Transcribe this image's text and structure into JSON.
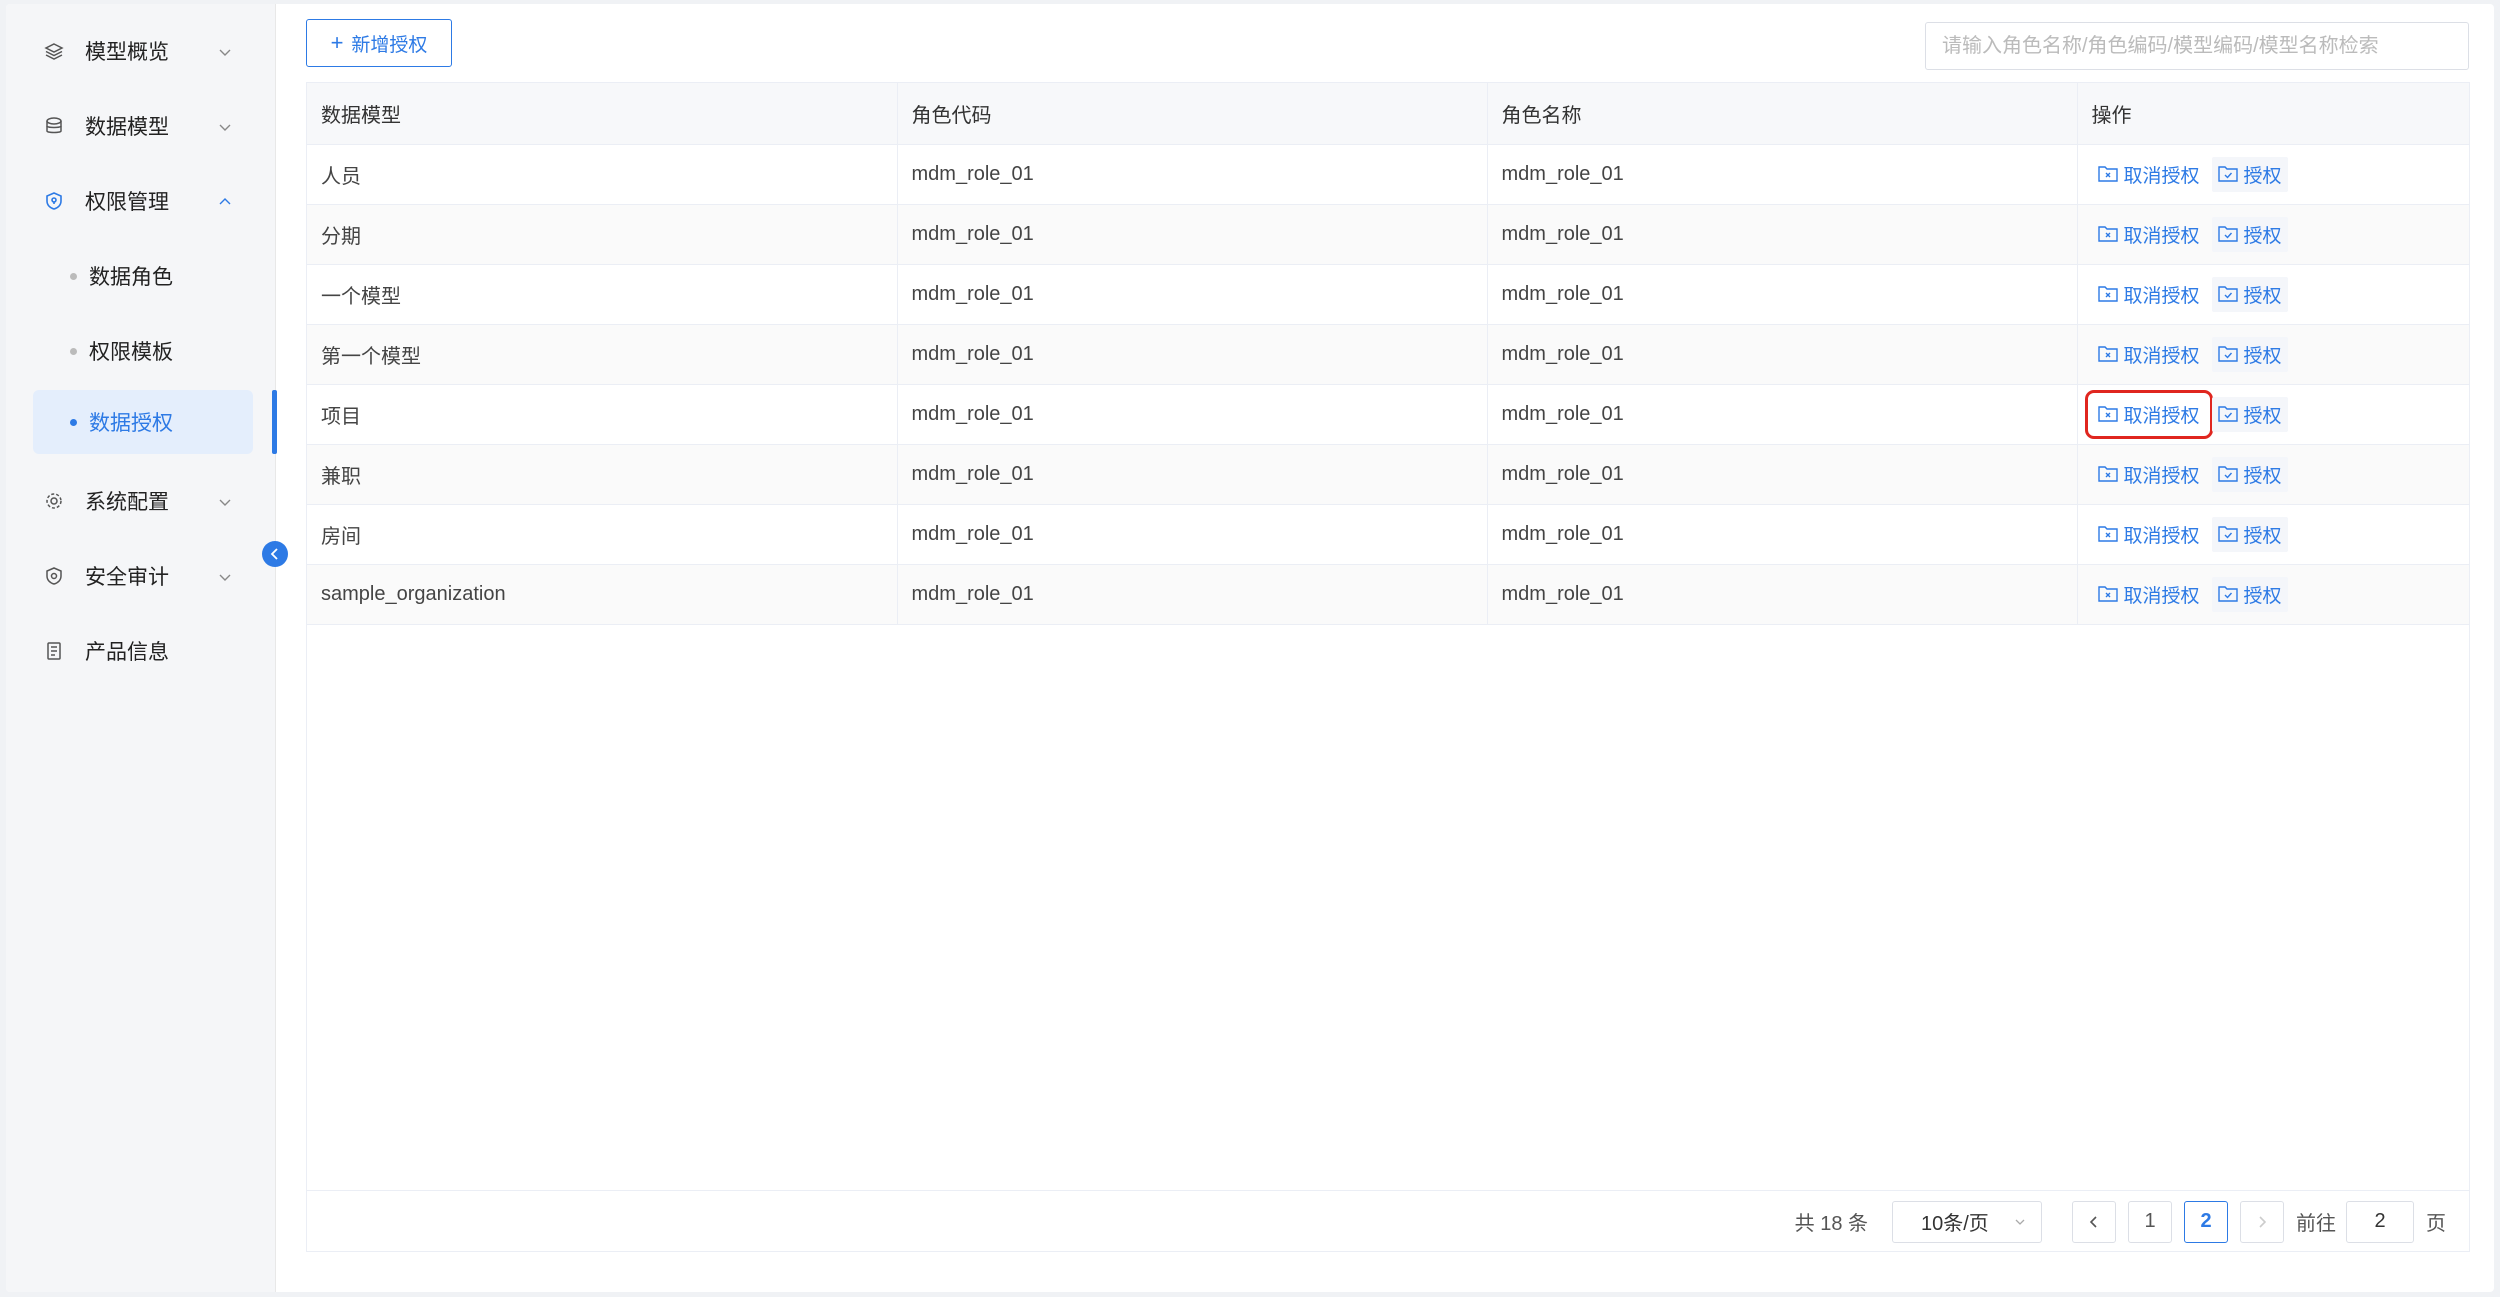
{
  "sidebar": {
    "items": [
      {
        "label": "模型概览",
        "icon": "layers-icon",
        "expanded": false
      },
      {
        "label": "数据模型",
        "icon": "database-icon",
        "expanded": false
      },
      {
        "label": "权限管理",
        "icon": "shield-icon",
        "expanded": true
      },
      {
        "label": "数据角色",
        "sub": true
      },
      {
        "label": "权限模板",
        "sub": true
      },
      {
        "label": "数据授权",
        "sub": true,
        "active": true
      },
      {
        "label": "系统配置",
        "icon": "gear-icon",
        "expanded": false
      },
      {
        "label": "安全审计",
        "icon": "audit-icon",
        "expanded": false
      },
      {
        "label": "产品信息",
        "icon": "document-icon"
      }
    ]
  },
  "toolbar": {
    "add_label": "新增授权",
    "search_placeholder": "请输入角色名称/角色编码/模型编码/模型名称检索"
  },
  "table": {
    "headers": [
      "数据模型",
      "角色代码",
      "角色名称",
      "操作"
    ],
    "rows": [
      [
        "人员",
        "mdm_role_01",
        "mdm_role_01"
      ],
      [
        "分期",
        "mdm_role_01",
        "mdm_role_01"
      ],
      [
        "一个模型",
        "mdm_role_01",
        "mdm_role_01"
      ],
      [
        "第一个模型",
        "mdm_role_01",
        "mdm_role_01"
      ],
      [
        "项目",
        "mdm_role_01",
        "mdm_role_01"
      ],
      [
        "兼职",
        "mdm_role_01",
        "mdm_role_01"
      ],
      [
        "房间",
        "mdm_role_01",
        "mdm_role_01"
      ],
      [
        "sample_organization",
        "mdm_role_01",
        "mdm_role_01"
      ]
    ],
    "op_revoke": "取消授权",
    "op_grant": "授权",
    "highlighted_row": 4
  },
  "pagination": {
    "total": "共 18 条",
    "page_size": "10条/页",
    "pages": [
      "1",
      "2"
    ],
    "current": "2",
    "goto_label": "前往",
    "goto_value": "2",
    "page_suffix": "页"
  },
  "colors": {
    "accent": "#2d7ae5",
    "highlight": "#e0261f"
  }
}
